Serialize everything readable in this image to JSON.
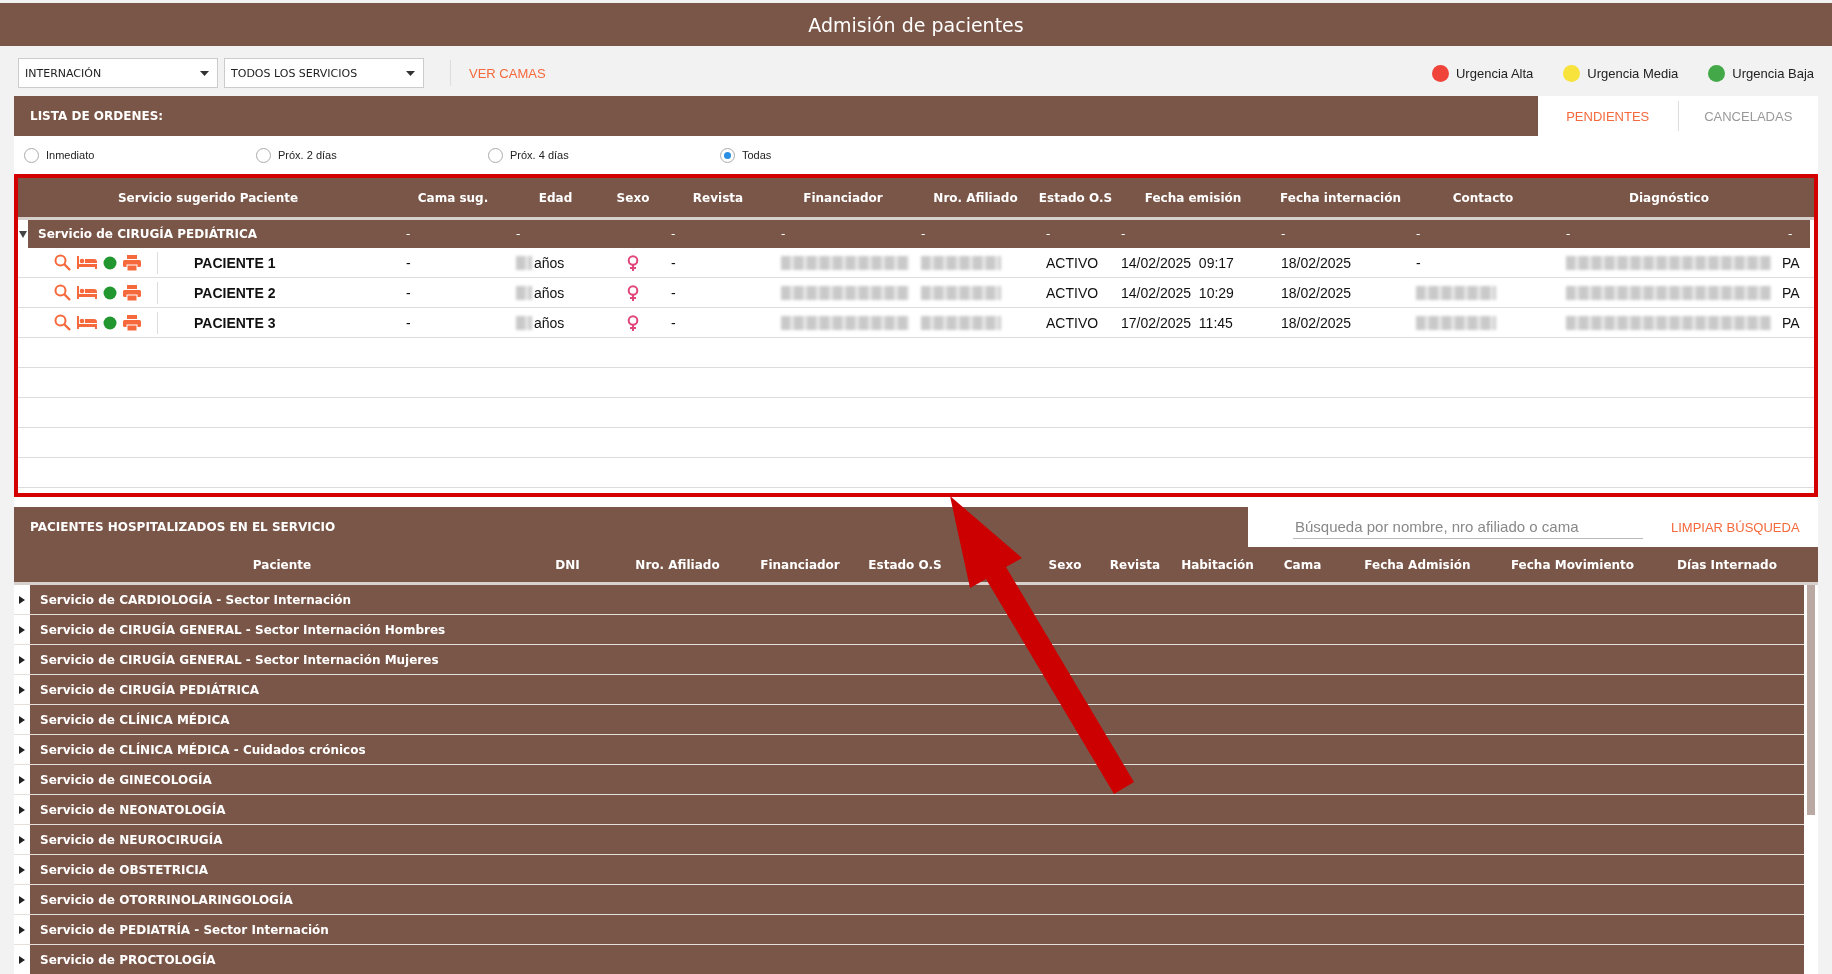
{
  "window": {
    "title": "Admisión de pacientes"
  },
  "toolbar": {
    "dropdowns": [
      {
        "value": "INTERNACIÓN"
      },
      {
        "value": "TODOS LOS SERVICIOS"
      }
    ],
    "link": "VER CAMAS"
  },
  "legend": [
    {
      "label": "Urgencia Alta",
      "color": "#f0443a"
    },
    {
      "label": "Urgencia Media",
      "color": "#f7e33c"
    },
    {
      "label": "Urgencia Baja",
      "color": "#43a847"
    }
  ],
  "orders": {
    "title": "LISTA DE ORDENES:",
    "tabs": [
      {
        "label": "PENDIENTES",
        "selected": true
      },
      {
        "label": "CANCELADAS",
        "selected": false
      }
    ],
    "filters": [
      {
        "label": "Inmediato",
        "selected": false
      },
      {
        "label": "Próx. 2 días",
        "selected": false
      },
      {
        "label": "Próx. 4 días",
        "selected": false
      },
      {
        "label": "Todas",
        "selected": true
      }
    ],
    "columns": [
      "Servicio sugerido Paciente",
      "Cama sug.",
      "Edad",
      "Sexo",
      "Revista",
      "Financiador",
      "Nro. Afiliado",
      "Estado O.S",
      "Fecha emisión",
      "Fecha internación",
      "Contacto",
      "Diagnóstico"
    ],
    "group": {
      "label": "Servicio de CIRUGÍA PEDIÁTRICA",
      "expanded": true,
      "cells": [
        "-",
        "-",
        null,
        "-",
        "-",
        "-",
        "-",
        "-",
        "-",
        "-",
        "-",
        "-"
      ]
    },
    "rows": [
      {
        "name": "PACIENTE 1",
        "color": "#22962f",
        "cama": "-",
        "edad": "años",
        "female": true,
        "revista": "-",
        "estado": "ACTIVO",
        "fecha_emision": "14/02/2025  09:17",
        "fecha_internacion": "18/02/2025",
        "contacto": "-",
        "column_13": "PA"
      },
      {
        "name": "PACIENTE 2",
        "color": "#22962f",
        "cama": "-",
        "edad": "años",
        "female": true,
        "revista": "-",
        "estado": "ACTIVO",
        "fecha_emision": "14/02/2025  10:29",
        "fecha_internacion": "18/02/2025",
        "contacto_redacted": true,
        "column_13": "PA"
      },
      {
        "name": "PACIENTE 3",
        "color": "#22962f",
        "cama": "-",
        "edad": "años",
        "female": true,
        "revista": "-",
        "estado": "ACTIVO",
        "fecha_emision": "17/02/2025  11:45",
        "fecha_internacion": "18/02/2025",
        "contacto_redacted": true,
        "column_13": "PA"
      }
    ]
  },
  "hospitalized": {
    "title": "PACIENTES HOSPITALIZADOS EN EL SERVICIO",
    "search": {
      "placeholder": "Búsqueda por nombre, nro afiliado o cama"
    },
    "clear_button": "LIMPIAR BÚSQUEDA",
    "columns": [
      "Paciente",
      "DNI",
      "Nro. Afiliado",
      "Financiador",
      "Estado O.S",
      "Sexo",
      "Revista",
      "Habitación",
      "Cama",
      "Fecha Admisión",
      "Fecha Movimiento",
      "Días Internado"
    ],
    "groups": [
      {
        "label": "Servicio de CARDIOLOGÍA - Sector Internación",
        "expanded": false
      },
      {
        "label": "Servicio de CIRUGÍA GENERAL - Sector Internación Hombres",
        "expanded": false
      },
      {
        "label": "Servicio de CIRUGÍA GENERAL - Sector Internación Mujeres",
        "expanded": false
      },
      {
        "label": "Servicio de CIRUGÍA PEDIÁTRICA",
        "expanded": false
      },
      {
        "label": "Servicio de CLÍNICA MÉDICA",
        "expanded": false
      },
      {
        "label": "Servicio de CLÍNICA MÉDICA - Cuidados crónicos",
        "expanded": false
      },
      {
        "label": "Servicio de GINECOLOGÍA",
        "expanded": false
      },
      {
        "label": "Servicio de NEONATOLOGÍA",
        "expanded": false
      },
      {
        "label": "Servicio de NEUROCIRUGÍA",
        "expanded": false
      },
      {
        "label": "Servicio de OBSTETRICIA",
        "expanded": false
      },
      {
        "label": "Servicio de OTORRINOLARINGOLOGÍA",
        "expanded": false
      },
      {
        "label": "Servicio de PEDIATRÍA - Sector Internación",
        "expanded": false
      },
      {
        "label": "Servicio de PROCTOLOGÍA",
        "expanded": false
      }
    ]
  }
}
